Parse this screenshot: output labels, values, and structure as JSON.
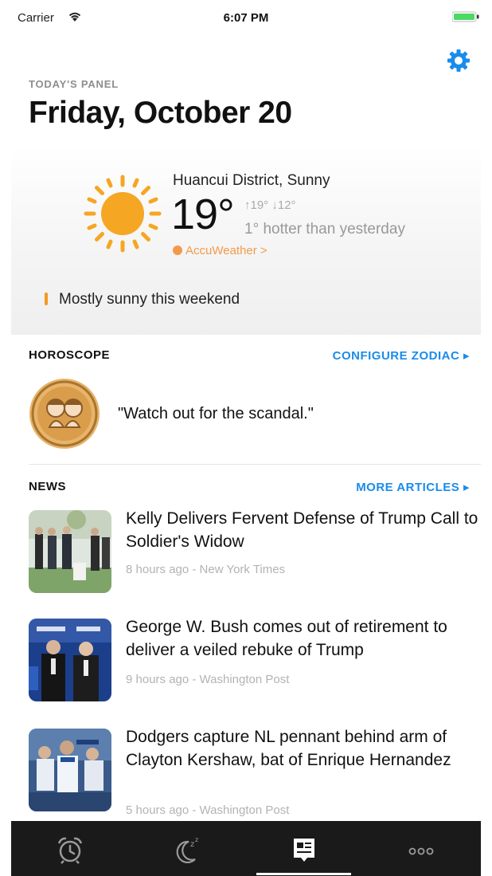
{
  "status_bar": {
    "carrier": "Carrier",
    "time": "6:07 PM"
  },
  "header": {
    "panel_label": "TODAY'S PANEL",
    "date": "Friday, October 20",
    "settings_icon": "gear-icon"
  },
  "weather": {
    "location": "Huancui District, Sunny",
    "temperature": "19°",
    "hilo": "↑19° ↓12°",
    "comparison": "1° hotter than yesterday",
    "source": "AccuWeather >",
    "forecast": "Mostly sunny this weekend",
    "icon": "sun-icon"
  },
  "horoscope": {
    "title": "HOROSCOPE",
    "configure": "CONFIGURE ZODIAC ▸",
    "quote": "\"Watch out for the scandal.\"",
    "icon": "gemini-zodiac-icon"
  },
  "news": {
    "title": "NEWS",
    "more": "MORE ARTICLES ▸",
    "articles": [
      {
        "headline": "Kelly Delivers Fervent Defense of Trump Call to Soldier's Widow",
        "meta": "8 hours ago - New York Times"
      },
      {
        "headline": "George W. Bush comes out of retirement to deliver a veiled rebuke of Trump",
        "meta": "9 hours ago - Washington Post"
      },
      {
        "headline": "Dodgers capture NL pennant behind arm of Clayton Kershaw, bat of Enrique Hernandez",
        "meta": "5 hours ago - Washington Post"
      }
    ]
  },
  "tab_bar": {
    "tabs": [
      "alarm-clock-icon",
      "sleep-moon-icon",
      "today-panel-icon",
      "more-icon"
    ],
    "active_index": 2
  },
  "colors": {
    "accent": "#1a8ceb",
    "weather_accent": "#f39a4a",
    "sun": "#f5a623",
    "tab_bar": "#1a1a1a"
  }
}
